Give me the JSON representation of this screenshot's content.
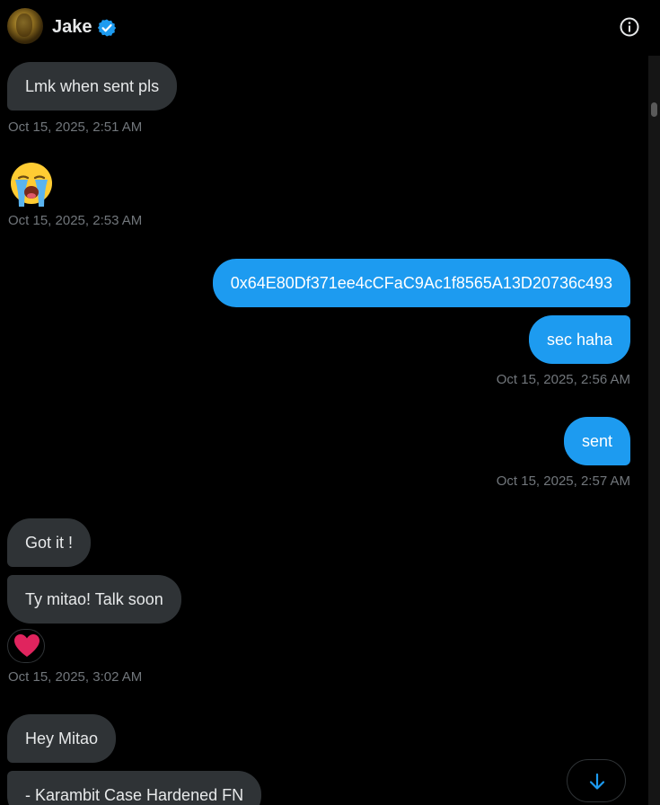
{
  "header": {
    "contact_name": "Jake"
  },
  "messages": {
    "m1": {
      "text": "Lmk when sent pls"
    },
    "t1": "Oct 15, 2025, 2:51 AM",
    "m2_emoji": "😭",
    "t2": "Oct 15, 2025, 2:53 AM",
    "m3": {
      "text": "0x64E80Df371ee4cCFaC9Ac1f8565A13D20736c493"
    },
    "m4": {
      "text": "sec haha"
    },
    "t3": "Oct 15, 2025, 2:56 AM",
    "m5": {
      "text": "sent"
    },
    "t4": "Oct 15, 2025, 2:57 AM",
    "m6": {
      "text": "Got it !"
    },
    "m7": {
      "text": "Ty mitao! Talk soon"
    },
    "reaction": "heart",
    "t5": "Oct 15, 2025, 3:02 AM",
    "m8": {
      "text": "Hey Mitao"
    },
    "m9": {
      "text": "- Karambit Case Hardened FN"
    }
  },
  "colors": {
    "background": "#000000",
    "incoming_bubble": "#2f3336",
    "outgoing_bubble": "#1d9bf0",
    "timestamp": "#71767b",
    "verified": "#1d9bf0",
    "reaction_heart": "#f91880"
  },
  "icons": {
    "verified": "verified-badge-icon",
    "info": "info-icon",
    "reaction": "heart-icon",
    "scroll_down": "arrow-down-icon"
  }
}
